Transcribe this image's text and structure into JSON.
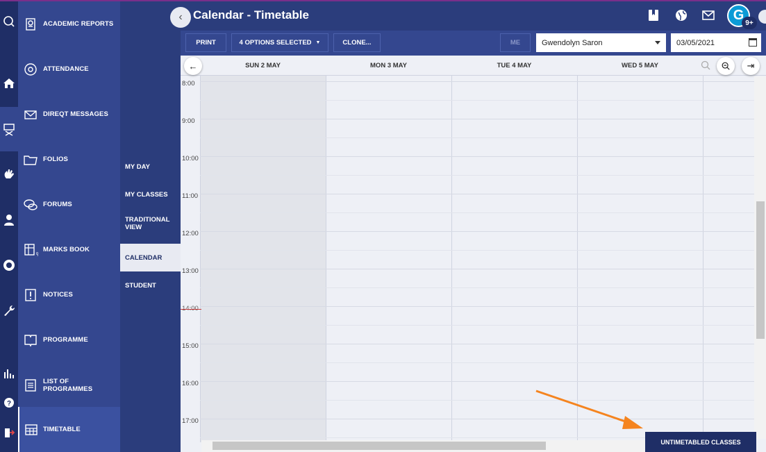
{
  "header": {
    "title": "Calendar - Timetable",
    "notification_count": "9+",
    "avatar_letter": "G"
  },
  "modules": [
    {
      "label": "ACADEMIC REPORTS",
      "icon": "report-icon"
    },
    {
      "label": "ATTENDANCE",
      "icon": "at-sign-icon"
    },
    {
      "label": "DIREQT MESSAGES",
      "icon": "message-icon"
    },
    {
      "label": "FOLIOS",
      "icon": "folder-icon"
    },
    {
      "label": "FORUMS",
      "icon": "forum-icon"
    },
    {
      "label": "MARKS BOOK",
      "icon": "marks-book-icon"
    },
    {
      "label": "NOTICES",
      "icon": "notice-icon"
    },
    {
      "label": "PROGRAMME",
      "icon": "book-icon"
    },
    {
      "label": "LIST OF PROGRAMMES",
      "icon": "list-icon"
    },
    {
      "label": "TIMETABLE",
      "icon": "timetable-icon"
    }
  ],
  "submenu": [
    {
      "label": "MY DAY"
    },
    {
      "label": "MY CLASSES"
    },
    {
      "label": "TRADITIONAL VIEW"
    },
    {
      "label": "CALENDAR"
    },
    {
      "label": "STUDENT"
    }
  ],
  "toolbar": {
    "print_label": "PRINT",
    "options_label": "4 OPTIONS SELECTED",
    "clone_label": "CLONE...",
    "me_label": "ME",
    "user_value": "Gwendolyn Saron",
    "date_value": "03/05/2021"
  },
  "calendar": {
    "days": [
      "SUN 2 MAY",
      "MON 3 MAY",
      "TUE 4 MAY",
      "WED 5 MAY"
    ],
    "times": [
      "8:00",
      "9:00",
      "10:00",
      "11:00",
      "12:00",
      "13:00",
      "14:00",
      "15:00",
      "16:00",
      "17:00"
    ]
  },
  "untimetabled_label": "UNTIMETABLED CLASSES",
  "colors": {
    "rail": "#1f2e66",
    "sidebar": "#34478f",
    "header": "#2b3d7c",
    "calendar_bg": "#eef0f6",
    "arrow": "#f5841f",
    "now_line": "#c83a3a"
  }
}
